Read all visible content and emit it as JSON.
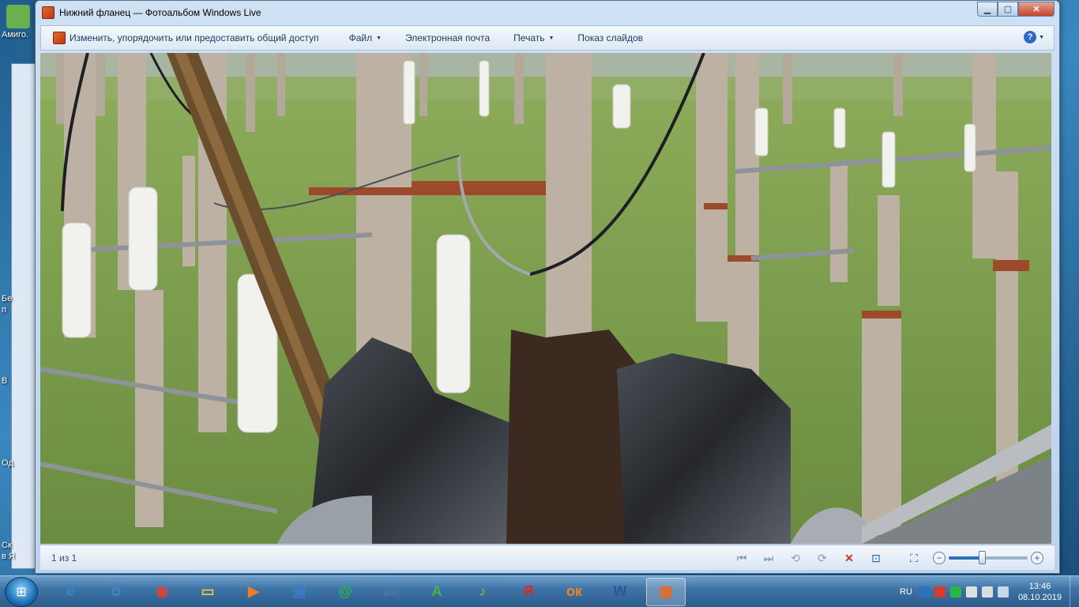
{
  "window": {
    "title": "Нижний фланец — Фотоальбом Windows Live",
    "controls": {
      "minimize": "▁",
      "maximize": "▢",
      "close": "✕"
    }
  },
  "menu": {
    "items": [
      {
        "label": "Изменить, упорядочить или предоставить общий доступ",
        "icon": "photo-gallery-icon",
        "dropdown": false
      },
      {
        "label": "Файл",
        "dropdown": true
      },
      {
        "label": "Электронная почта",
        "dropdown": false
      },
      {
        "label": "Печать",
        "dropdown": true
      },
      {
        "label": "Показ слайдов",
        "dropdown": false
      }
    ],
    "help_label": "?"
  },
  "photo": {
    "description_icon": "substation-photo",
    "colors": {
      "grass": "#7a9a4c",
      "sky": "#b9c3b0",
      "pole": "#b8ab9c",
      "insulator": "#f2f2ee"
    }
  },
  "statusbar": {
    "counter": "1 из 1",
    "controls": [
      "previous-icon",
      "next-icon",
      "rotate-left-icon",
      "rotate-right-icon",
      "delete-icon",
      "slideshow-icon",
      "fit-to-window-icon"
    ],
    "zoom_level": 0.42
  },
  "desktop": {
    "icons": [
      {
        "label": "Амиго.",
        "color": "#6ab04c"
      }
    ],
    "side_labels": [
      "Бе",
      "п",
      "В",
      "Од",
      "Ск",
      "в Я"
    ]
  },
  "taskbar": {
    "apps": [
      {
        "name": "internet-explorer-icon",
        "glyph": "e",
        "color": "#2d86d6"
      },
      {
        "name": "users-icon",
        "glyph": "☺",
        "color": "#4aa3df"
      },
      {
        "name": "chrome-icon",
        "glyph": "◉",
        "color": "#db4437"
      },
      {
        "name": "explorer-icon",
        "glyph": "▭",
        "color": "#e8c34a"
      },
      {
        "name": "media-player-icon",
        "glyph": "▶",
        "color": "#f07c28"
      },
      {
        "name": "briefcase-icon",
        "glyph": "▣",
        "color": "#3c7bbf"
      },
      {
        "name": "mail-icon",
        "glyph": "@",
        "color": "#2ab54b"
      },
      {
        "name": "vk-icon",
        "glyph": "вк",
        "color": "#4a76a8"
      },
      {
        "name": "amigo-icon",
        "glyph": "A",
        "color": "#47b443"
      },
      {
        "name": "music-icon",
        "glyph": "♪",
        "color": "#8bc34a"
      },
      {
        "name": "yandex-icon",
        "glyph": "Я",
        "color": "#e52620"
      },
      {
        "name": "odnoklassniki-icon",
        "glyph": "ок",
        "color": "#f58220"
      },
      {
        "name": "word-icon",
        "glyph": "W",
        "color": "#2b5797"
      },
      {
        "name": "photo-gallery-icon",
        "glyph": "▦",
        "color": "#e46b2a"
      }
    ],
    "tray": {
      "lang": "RU",
      "time": "13:46",
      "date": "08.10.2019"
    }
  }
}
